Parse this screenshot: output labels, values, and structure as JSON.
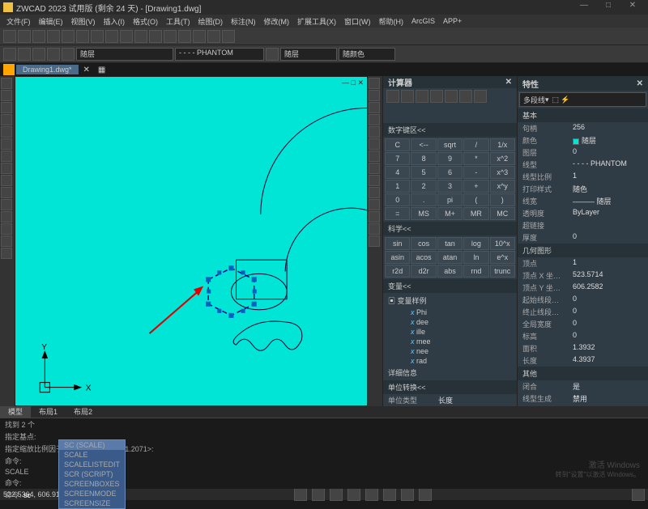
{
  "title": "ZWCAD 2023 试用版 (剩余 24 天) - [Drawing1.dwg]",
  "menu": [
    "文件(F)",
    "编辑(E)",
    "视图(V)",
    "插入(I)",
    "格式(O)",
    "工具(T)",
    "绘图(D)",
    "标注(N)",
    "修改(M)",
    "扩展工具(X)",
    "窗口(W)",
    "帮助(H)",
    "ArcGIS",
    "APP+"
  ],
  "layer_select": "随层",
  "linetype_select": "- - - - PHANTOM",
  "color_select": "随颜色",
  "tab_name": "Drawing1.dwg*",
  "model_tabs": [
    "模型",
    "布局1",
    "布局2"
  ],
  "calc": {
    "title": "计算器",
    "sect_num": "数字键区<<",
    "num_keys": [
      [
        "C",
        "<--",
        "sqrt",
        "/",
        "1/x"
      ],
      [
        "7",
        "8",
        "9",
        "*",
        "x^2"
      ],
      [
        "4",
        "5",
        "6",
        "-",
        "x^3"
      ],
      [
        "1",
        "2",
        "3",
        "+",
        "x^y"
      ],
      [
        "0",
        ".",
        "pi",
        "(",
        ")"
      ],
      [
        "=",
        "MS",
        "M+",
        "MR",
        "MC"
      ]
    ],
    "sect_sci": "科学<<",
    "sci_keys": [
      [
        "sin",
        "cos",
        "tan",
        "log",
        "10^x"
      ],
      [
        "asin",
        "acos",
        "atan",
        "ln",
        "e^x"
      ],
      [
        "r2d",
        "d2r",
        "abs",
        "rnd",
        "trunc"
      ]
    ],
    "sect_var": "变量<<",
    "var_root": "变量样例",
    "vars": [
      "Phi",
      "dee",
      "ille",
      "mee",
      "nee",
      "rad"
    ],
    "var_detail": "详细信息",
    "sect_unit": "单位转换<<",
    "unit_labels": [
      "单位类型",
      "长度"
    ]
  },
  "props": {
    "title": "特性",
    "entity_type": "多段线",
    "groups": {
      "basic": {
        "label": "基本",
        "rows": [
          {
            "k": "句柄",
            "v": "256"
          },
          {
            "k": "颜色",
            "v": "随层",
            "sw": "#00e5d5"
          },
          {
            "k": "图层",
            "v": "0"
          },
          {
            "k": "线型",
            "v": "- - - - PHANTOM"
          },
          {
            "k": "线型比例",
            "v": "1"
          },
          {
            "k": "打印样式",
            "v": "随色"
          },
          {
            "k": "线宽",
            "v": "——— 随层"
          },
          {
            "k": "透明度",
            "v": "ByLayer"
          },
          {
            "k": "超链接",
            "v": ""
          },
          {
            "k": "厚度",
            "v": "0"
          }
        ]
      },
      "geom": {
        "label": "几何图形",
        "rows": [
          {
            "k": "顶点",
            "v": "1"
          },
          {
            "k": "顶点 X 坐…",
            "v": "523.5714"
          },
          {
            "k": "顶点 Y 坐…",
            "v": "606.2582"
          },
          {
            "k": "起始线段…",
            "v": "0"
          },
          {
            "k": "终止线段…",
            "v": "0"
          },
          {
            "k": "全局宽度",
            "v": "0"
          },
          {
            "k": "标高",
            "v": "0"
          },
          {
            "k": "面积",
            "v": "1.3932"
          },
          {
            "k": "长度",
            "v": "4.3937"
          }
        ]
      },
      "other": {
        "label": "其他",
        "rows": [
          {
            "k": "闭合",
            "v": "是"
          },
          {
            "k": "线型生成",
            "v": "禁用"
          }
        ]
      }
    }
  },
  "cmd": {
    "lines": [
      "找到 2 个",
      "指定基点:",
      "指定缩放比例因子[复制(C)/参照(R)] <1.2071>:",
      "命令:",
      "SCALE",
      "命令:"
    ],
    "prompt_label": "命令:",
    "prompt_value": "sc",
    "autocomplete": [
      "SC (SCALE)",
      "SCALE",
      "SCALELISTEDIT",
      "SCR (SCRIPT)",
      "SCREENBOXES",
      "SCREENMODE",
      "SCREENSIZE"
    ]
  },
  "status": {
    "coords": "522.5364, 606.9105, 0.0000"
  },
  "watermark": {
    "l1": "激活 Windows",
    "l2": "转到\"设置\"以激活 Windows。"
  }
}
